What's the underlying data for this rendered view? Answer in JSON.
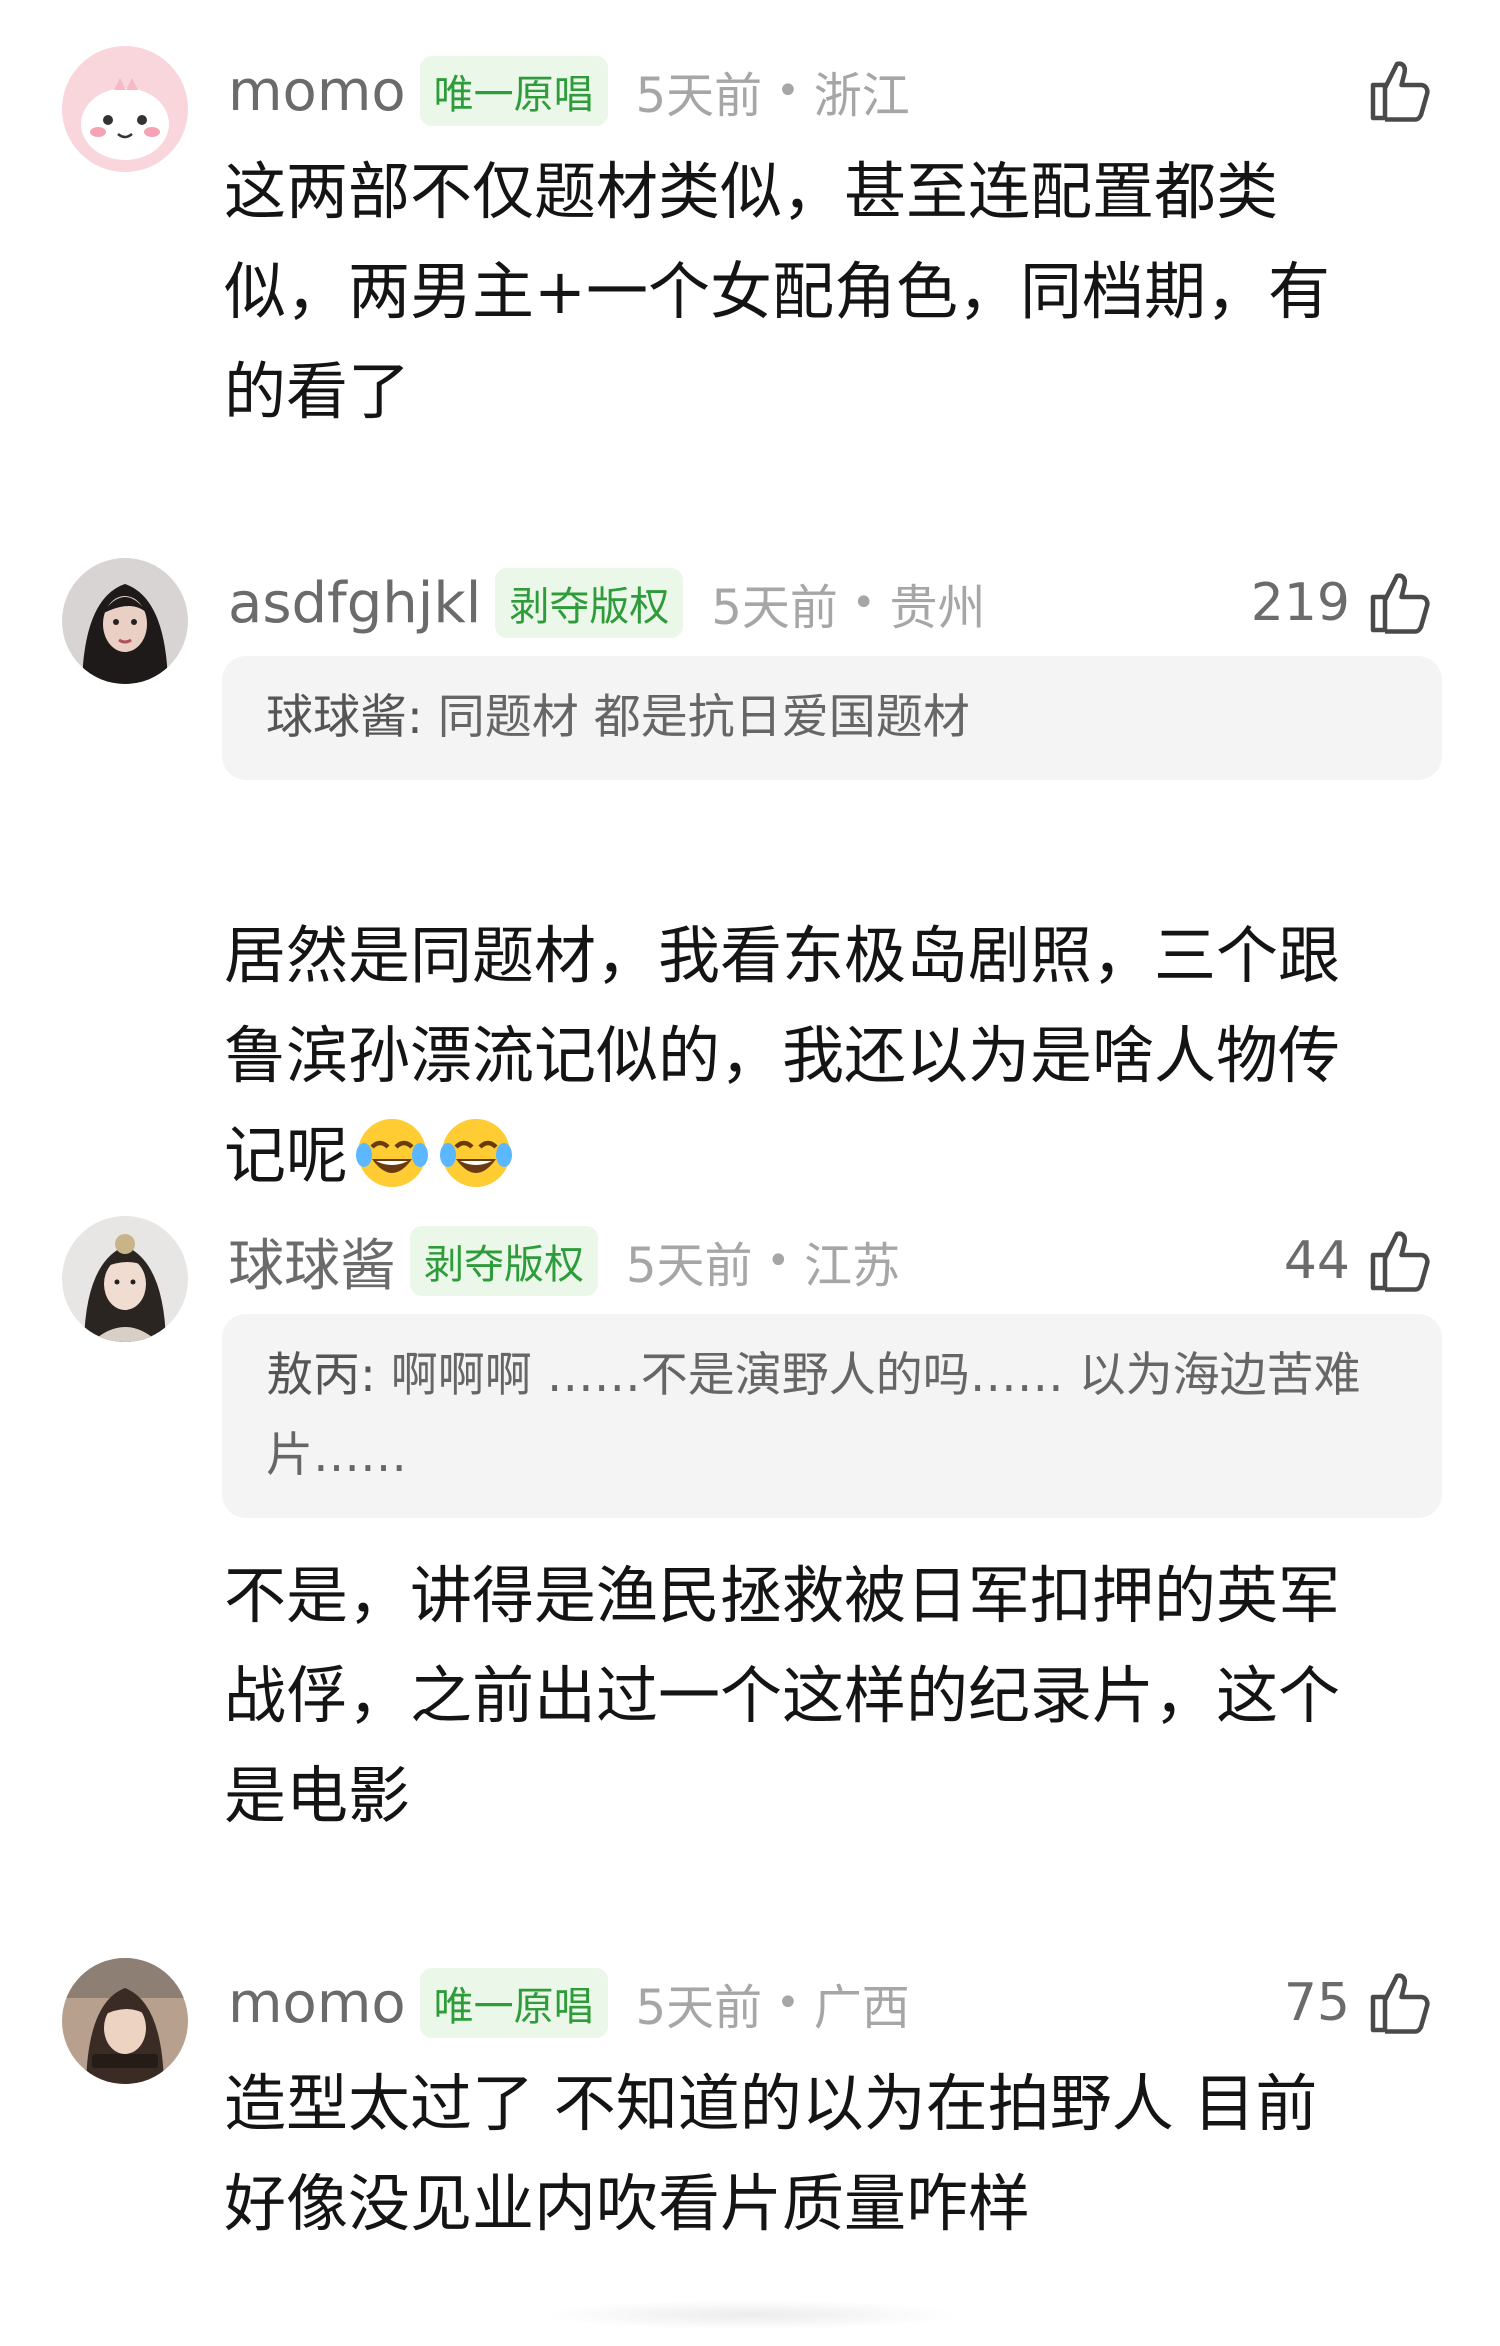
{
  "comments": [
    {
      "username": "momo",
      "badge": "唯一原唱",
      "time": "5天前",
      "sep": "•",
      "location": "浙江",
      "likes": "",
      "quote": null,
      "text": "这两部不仅题材类似，甚至连配置都类\n似，两男主+一个女配角色，同档期，有\n的看了"
    },
    {
      "username": "asdfghjkl",
      "badge": "剥夺版权",
      "time": "5天前",
      "sep": "•",
      "location": "贵州",
      "likes": "219",
      "quote_name": "球球酱:",
      "quote_text": " 同题材 都是抗日爱国题材",
      "text": "居然是同题材，我看东极岛剧照，三个跟\n鲁滨孙漂流记似的，我还以为是啥人物传\n记呢"
    },
    {
      "username": "球球酱",
      "badge": "剥夺版权",
      "time": "5天前",
      "sep": "•",
      "location": "江苏",
      "likes": "44",
      "quote_name": "敖丙:",
      "quote_text": " 啊啊啊  ……不是演野人的吗……  以为海边苦难片……",
      "text": "不是，讲得是渔民拯救被日军扣押的英军\n战俘，之前出过一个这样的纪录片，这个\n是电影"
    },
    {
      "username": "momo",
      "badge": "唯一原唱",
      "time": "5天前",
      "sep": "•",
      "location": "广西",
      "likes": "75",
      "quote": null,
      "text": "造型太过了 不知道的以为在拍野人 目前\n好像没见业内吹看片质量咋样"
    }
  ],
  "icons": {
    "like": "thumbs-up-icon",
    "emoji": "tears-of-joy-emoji"
  },
  "colors": {
    "badge_bg": "#ebf7e8",
    "badge_text": "#2f9c3b",
    "quote_bg": "#f4f4f4"
  }
}
